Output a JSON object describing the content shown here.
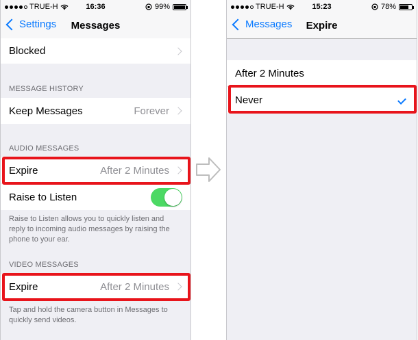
{
  "left_screen": {
    "status": {
      "carrier": "TRUE-H",
      "time": "16:36",
      "battery": "99%",
      "battery_level": 0.99
    },
    "nav": {
      "back_label": "Settings",
      "title": "Messages"
    },
    "blocked_row": {
      "label": "Blocked"
    },
    "message_history": {
      "header": "MESSAGE HISTORY",
      "keep_messages": {
        "label": "Keep Messages",
        "value": "Forever"
      }
    },
    "audio_messages": {
      "header": "AUDIO MESSAGES",
      "expire": {
        "label": "Expire",
        "value": "After 2 Minutes"
      },
      "raise_to_listen": {
        "label": "Raise to Listen",
        "enabled": true
      },
      "footer": "Raise to Listen allows you to quickly listen and reply to incoming audio messages by raising the phone to your ear."
    },
    "video_messages": {
      "header": "VIDEO MESSAGES",
      "expire": {
        "label": "Expire",
        "value": "After 2 Minutes"
      },
      "footer": "Tap and hold the camera button in Messages to quickly send videos."
    }
  },
  "right_screen": {
    "status": {
      "carrier": "TRUE-H",
      "time": "15:23",
      "battery": "78%",
      "battery_level": 0.78
    },
    "nav": {
      "back_label": "Messages",
      "title": "Expire"
    },
    "options": [
      {
        "label": "After 2 Minutes",
        "selected": false
      },
      {
        "label": "Never",
        "selected": true
      }
    ]
  },
  "colors": {
    "accent": "#0a7aff",
    "highlight": "#e8141b",
    "toggle_on": "#4cd964"
  }
}
